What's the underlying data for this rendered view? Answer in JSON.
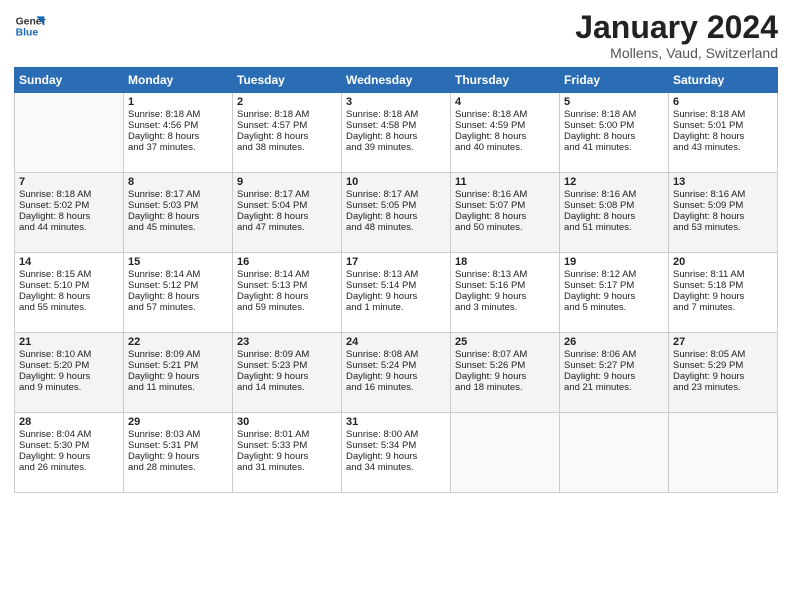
{
  "logo": {
    "line1": "General",
    "line2": "Blue"
  },
  "title": "January 2024",
  "subtitle": "Mollens, Vaud, Switzerland",
  "header_days": [
    "Sunday",
    "Monday",
    "Tuesday",
    "Wednesday",
    "Thursday",
    "Friday",
    "Saturday"
  ],
  "weeks": [
    [
      {
        "day": "",
        "info": ""
      },
      {
        "day": "1",
        "info": "Sunrise: 8:18 AM\nSunset: 4:56 PM\nDaylight: 8 hours\nand 37 minutes."
      },
      {
        "day": "2",
        "info": "Sunrise: 8:18 AM\nSunset: 4:57 PM\nDaylight: 8 hours\nand 38 minutes."
      },
      {
        "day": "3",
        "info": "Sunrise: 8:18 AM\nSunset: 4:58 PM\nDaylight: 8 hours\nand 39 minutes."
      },
      {
        "day": "4",
        "info": "Sunrise: 8:18 AM\nSunset: 4:59 PM\nDaylight: 8 hours\nand 40 minutes."
      },
      {
        "day": "5",
        "info": "Sunrise: 8:18 AM\nSunset: 5:00 PM\nDaylight: 8 hours\nand 41 minutes."
      },
      {
        "day": "6",
        "info": "Sunrise: 8:18 AM\nSunset: 5:01 PM\nDaylight: 8 hours\nand 43 minutes."
      }
    ],
    [
      {
        "day": "7",
        "info": "Sunrise: 8:18 AM\nSunset: 5:02 PM\nDaylight: 8 hours\nand 44 minutes."
      },
      {
        "day": "8",
        "info": "Sunrise: 8:17 AM\nSunset: 5:03 PM\nDaylight: 8 hours\nand 45 minutes."
      },
      {
        "day": "9",
        "info": "Sunrise: 8:17 AM\nSunset: 5:04 PM\nDaylight: 8 hours\nand 47 minutes."
      },
      {
        "day": "10",
        "info": "Sunrise: 8:17 AM\nSunset: 5:05 PM\nDaylight: 8 hours\nand 48 minutes."
      },
      {
        "day": "11",
        "info": "Sunrise: 8:16 AM\nSunset: 5:07 PM\nDaylight: 8 hours\nand 50 minutes."
      },
      {
        "day": "12",
        "info": "Sunrise: 8:16 AM\nSunset: 5:08 PM\nDaylight: 8 hours\nand 51 minutes."
      },
      {
        "day": "13",
        "info": "Sunrise: 8:16 AM\nSunset: 5:09 PM\nDaylight: 8 hours\nand 53 minutes."
      }
    ],
    [
      {
        "day": "14",
        "info": "Sunrise: 8:15 AM\nSunset: 5:10 PM\nDaylight: 8 hours\nand 55 minutes."
      },
      {
        "day": "15",
        "info": "Sunrise: 8:14 AM\nSunset: 5:12 PM\nDaylight: 8 hours\nand 57 minutes."
      },
      {
        "day": "16",
        "info": "Sunrise: 8:14 AM\nSunset: 5:13 PM\nDaylight: 8 hours\nand 59 minutes."
      },
      {
        "day": "17",
        "info": "Sunrise: 8:13 AM\nSunset: 5:14 PM\nDaylight: 9 hours\nand 1 minute."
      },
      {
        "day": "18",
        "info": "Sunrise: 8:13 AM\nSunset: 5:16 PM\nDaylight: 9 hours\nand 3 minutes."
      },
      {
        "day": "19",
        "info": "Sunrise: 8:12 AM\nSunset: 5:17 PM\nDaylight: 9 hours\nand 5 minutes."
      },
      {
        "day": "20",
        "info": "Sunrise: 8:11 AM\nSunset: 5:18 PM\nDaylight: 9 hours\nand 7 minutes."
      }
    ],
    [
      {
        "day": "21",
        "info": "Sunrise: 8:10 AM\nSunset: 5:20 PM\nDaylight: 9 hours\nand 9 minutes."
      },
      {
        "day": "22",
        "info": "Sunrise: 8:09 AM\nSunset: 5:21 PM\nDaylight: 9 hours\nand 11 minutes."
      },
      {
        "day": "23",
        "info": "Sunrise: 8:09 AM\nSunset: 5:23 PM\nDaylight: 9 hours\nand 14 minutes."
      },
      {
        "day": "24",
        "info": "Sunrise: 8:08 AM\nSunset: 5:24 PM\nDaylight: 9 hours\nand 16 minutes."
      },
      {
        "day": "25",
        "info": "Sunrise: 8:07 AM\nSunset: 5:26 PM\nDaylight: 9 hours\nand 18 minutes."
      },
      {
        "day": "26",
        "info": "Sunrise: 8:06 AM\nSunset: 5:27 PM\nDaylight: 9 hours\nand 21 minutes."
      },
      {
        "day": "27",
        "info": "Sunrise: 8:05 AM\nSunset: 5:29 PM\nDaylight: 9 hours\nand 23 minutes."
      }
    ],
    [
      {
        "day": "28",
        "info": "Sunrise: 8:04 AM\nSunset: 5:30 PM\nDaylight: 9 hours\nand 26 minutes."
      },
      {
        "day": "29",
        "info": "Sunrise: 8:03 AM\nSunset: 5:31 PM\nDaylight: 9 hours\nand 28 minutes."
      },
      {
        "day": "30",
        "info": "Sunrise: 8:01 AM\nSunset: 5:33 PM\nDaylight: 9 hours\nand 31 minutes."
      },
      {
        "day": "31",
        "info": "Sunrise: 8:00 AM\nSunset: 5:34 PM\nDaylight: 9 hours\nand 34 minutes."
      },
      {
        "day": "",
        "info": ""
      },
      {
        "day": "",
        "info": ""
      },
      {
        "day": "",
        "info": ""
      }
    ]
  ]
}
